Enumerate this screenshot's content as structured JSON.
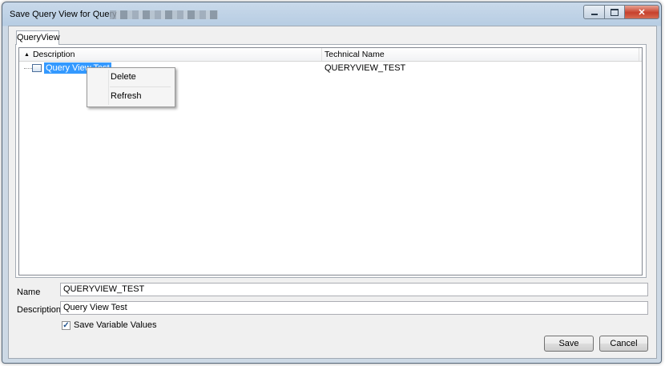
{
  "window": {
    "title": "Save Query View for Query"
  },
  "tabs": [
    {
      "label": "QueryView"
    }
  ],
  "list": {
    "columns": [
      "Description",
      "Technical Name"
    ],
    "rows": [
      {
        "description": "Query View Test",
        "technical_name": "QUERYVIEW_TEST"
      }
    ]
  },
  "context_menu": {
    "items": [
      "Delete",
      "Refresh"
    ]
  },
  "form": {
    "name_label": "Name",
    "name_value": "QUERYVIEW_TEST",
    "description_label": "Description",
    "description_value": "Query View Test",
    "save_variables_label": "Save Variable Values",
    "save_variables_checked": "✓"
  },
  "buttons": {
    "save": "Save",
    "cancel": "Cancel"
  },
  "icons": {
    "minimize": "minimize-icon",
    "maximize": "maximize-icon",
    "close": "close-icon",
    "sort_ascending": "sort-ascending-icon",
    "tree_node": "query-view-node-icon"
  },
  "colors": {
    "selection": "#3399ff",
    "close_button": "#c7412c"
  }
}
